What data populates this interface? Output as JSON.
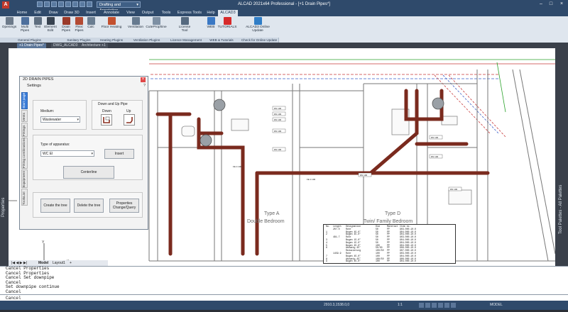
{
  "app": {
    "title": "ALCAD 2021x64 Professional - [+1 Drain Pipes*]",
    "workspace": "Drafting and Annotation",
    "logo_letter": "A"
  },
  "menu_tabs": [
    "Home",
    "Edit",
    "Draw",
    "Draw 3D",
    "Insert",
    "Annotate",
    "View",
    "Output",
    "Tools",
    "Express Tools",
    "Help",
    "ALCAD3"
  ],
  "ribbon": {
    "buttons": [
      {
        "label": "Openings",
        "icon": "openings-icon",
        "color": "#6c7a8a"
      },
      {
        "label": "Multi Pipes",
        "icon": "multi-pipes-icon",
        "color": "#4d6f9c"
      },
      {
        "label": "Text",
        "icon": "text-icon",
        "color": "#5e6e80"
      },
      {
        "label": "Element Edit",
        "icon": "element-edit-icon",
        "color": "#374250"
      },
      {
        "label": "Drain Pipes",
        "icon": "drain-pipes-icon",
        "color": "#9b3a2a"
      },
      {
        "label": "Flexi Pipes",
        "icon": "flexi-pipes-icon",
        "color": "#b34a33"
      },
      {
        "label": "Calc",
        "icon": "calc-icon",
        "color": "#6a7d91"
      },
      {
        "label": "Floor Heating",
        "icon": "floor-heating-icon",
        "color": "#c3502f"
      },
      {
        "label": "Ventilation",
        "icon": "ventilation-icon",
        "color": "#667a8f"
      },
      {
        "label": "CuteProphine",
        "icon": "cuteprophine-icon",
        "color": "#7d8fa3"
      },
      {
        "label": "License Tool",
        "icon": "license-icon",
        "color": "#55697f"
      },
      {
        "label": "WEB",
        "icon": "web-icon",
        "color": "#3a78c4"
      },
      {
        "label": "TUTORIALS",
        "icon": "youtube-icon",
        "color": "#d62a2a"
      },
      {
        "label": "ALCAD3 Online Update",
        "icon": "online-update-icon",
        "color": "#2f7dc6"
      }
    ],
    "groups": [
      "General Plugins",
      "Sanitary Plugins",
      "Heating Plugins",
      "Ventilation Plugins",
      "Licence Management",
      "WEB & Tutorials",
      "Check for Online Update"
    ]
  },
  "file_tabs": [
    "+1 Drain Pipes*",
    "DWG_ALCAD3",
    "Architecture +1"
  ],
  "side_labels": {
    "left": "Properties",
    "right_1": "Tool Palettes - All Palettes"
  },
  "dialog": {
    "title": "2D DRAIN PIPES",
    "subtitle": "Settings",
    "help": "?",
    "close": "×",
    "vertical_tabs": [
      "Start page",
      "Vents",
      "Fittings",
      "Fitting combinations",
      "Equipment",
      "ToolsList"
    ],
    "medium_label": "Medium:",
    "medium_value": "Wastewater",
    "down_up_title": "Down and Up Pipe",
    "down_label": "Down",
    "up_label": "Up",
    "apparatus_label": "Type of apparatus:",
    "apparatus_value": "WC El",
    "insert_label": "Insert",
    "centerline_label": "Centerline",
    "create_tree_label": "Create the tree",
    "delete_tree_label": "Delete the tree",
    "properties_label": "Properties Change/Query"
  },
  "drawing": {
    "room_a": "Type A",
    "room_a_sub": "Double Bedroom",
    "room_d": "Type D",
    "room_d_sub": "Twin/ Family Bedroom",
    "table_headers": [
      "No.",
      "Length",
      "Designation",
      "Dim",
      "Material",
      "Item no."
    ],
    "table_rows": [
      [
        "",
        "207.0",
        "Rohr",
        "50",
        "PP",
        "903.000.10.0"
      ],
      [
        "1",
        "",
        "Bogen 45.0°",
        "50",
        "PP",
        "904.000.10.0"
      ],
      [
        "2",
        "",
        "Bogen 45.0°",
        "50",
        "PP",
        "904.000.10.0"
      ],
      [
        "",
        "481.7",
        "Rohr",
        "50",
        "PP",
        "903.000.10.0"
      ],
      [
        "3",
        "",
        "Bogen 15.0°",
        "50",
        "PP",
        "904.000.10.0"
      ],
      [
        "4",
        "",
        "Bogen 15.0°",
        "50",
        "PP",
        "904.000.10.0"
      ],
      [
        "5",
        "",
        "Bogen 45.0°",
        "100",
        "PP",
        "904.000.10.0"
      ],
      [
        "6",
        "",
        "Abzweig 45°",
        "50/50",
        "PP",
        "906.000.10.0"
      ],
      [
        "",
        "",
        "Reduzierung",
        "100/50",
        "PP",
        "907.000.10.0"
      ],
      [
        "",
        "1459.9",
        "Rohr",
        "100",
        "PP",
        "903.000.10.0"
      ],
      [
        "7",
        "",
        "Bogen 45.0°",
        "100",
        "PP",
        "904.000.10.0"
      ],
      [
        "8",
        "",
        "Abzweig 45°",
        "100/50",
        "PP",
        "906.000.10.0"
      ],
      [
        "9",
        "",
        "Bogen 45.0°",
        "100",
        "PP",
        "904.000.10.0"
      ]
    ],
    "pipe_tag": "DN 100",
    "fall_tag": "FE 1:100"
  },
  "layout_tabs": [
    "Model",
    "Layout1",
    "+"
  ],
  "command_history": [
    "Cancel Properties",
    "Cancel Properties",
    "Cancel Set downpipe",
    "Cancel",
    "Set downpipe continue",
    "Cancel"
  ],
  "command_prompt": "Cancel",
  "status": {
    "coordinates": "2910.3,1538.0,0",
    "scale": "1:1",
    "mode": "MODEL"
  }
}
